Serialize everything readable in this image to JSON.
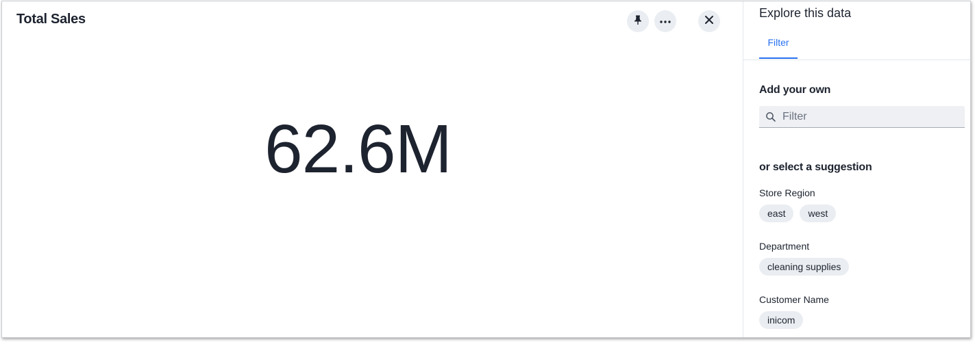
{
  "header": {
    "title": "Total Sales",
    "actions": [
      {
        "name": "pin-button",
        "icon": "pin-icon"
      },
      {
        "name": "more-options-button",
        "icon": "more-horizontal-icon"
      },
      {
        "name": "close-button",
        "icon": "close-icon"
      }
    ]
  },
  "kpi": {
    "value": "62.6M"
  },
  "explore": {
    "title": "Explore this data",
    "tabs": [
      {
        "label": "Filter",
        "active": true
      }
    ],
    "add_own_label": "Add your own",
    "filter_input": {
      "placeholder": "Filter",
      "value": ""
    },
    "suggestion_label": "or select a suggestion",
    "groups": [
      {
        "label": "Store Region",
        "chips": [
          "east",
          "west"
        ]
      },
      {
        "label": "Department",
        "chips": [
          "cleaning supplies"
        ]
      },
      {
        "label": "Customer Name",
        "chips": [
          "inicom"
        ]
      }
    ]
  },
  "colors": {
    "accent": "#2770ef",
    "text": "#1d232f",
    "chip_bg": "#eaedf1",
    "input_bg": "#eef0f3"
  }
}
